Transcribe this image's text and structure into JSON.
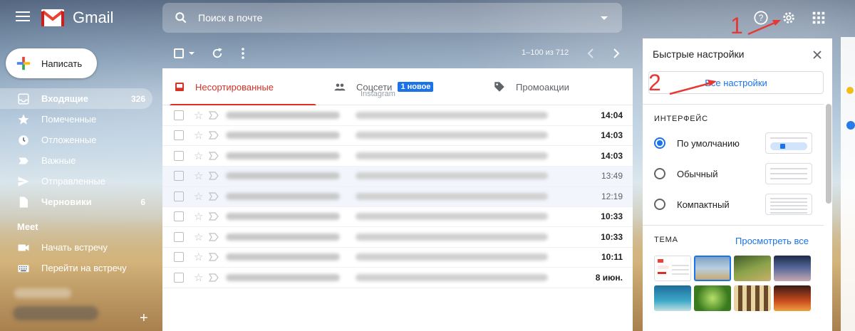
{
  "app": {
    "name": "Gmail"
  },
  "search": {
    "placeholder": "Поиск в почте"
  },
  "compose": {
    "label": "Написать"
  },
  "sidebar": {
    "items": [
      {
        "label": "Входящие",
        "count": "326",
        "icon": "inbox-icon",
        "active": true
      },
      {
        "label": "Помеченные",
        "count": "",
        "icon": "star-icon"
      },
      {
        "label": "Отложенные",
        "count": "",
        "icon": "clock-icon"
      },
      {
        "label": "Важные",
        "count": "",
        "icon": "label-important-icon"
      },
      {
        "label": "Отправленные",
        "count": "",
        "icon": "send-icon"
      },
      {
        "label": "Черновики",
        "count": "6",
        "icon": "draft-icon",
        "bold": true
      }
    ],
    "meet": {
      "title": "Meet",
      "items": [
        {
          "label": "Начать встречу",
          "icon": "videocam-icon"
        },
        {
          "label": "Перейти на встречу",
          "icon": "keyboard-icon"
        }
      ]
    }
  },
  "toolbar": {
    "pagination": "1–100 из 712"
  },
  "tabs": {
    "primary": {
      "label": "Несортированные"
    },
    "social": {
      "label": "Соцсети",
      "badge": "1 новое",
      "sub": "Instagram"
    },
    "promo": {
      "label": "Промоакции"
    }
  },
  "emails": [
    {
      "time": "14:04",
      "unread": true
    },
    {
      "time": "14:03",
      "unread": true
    },
    {
      "time": "14:03",
      "unread": true
    },
    {
      "time": "13:49",
      "unread": false
    },
    {
      "time": "12:19",
      "unread": false
    },
    {
      "time": "10:33",
      "unread": true
    },
    {
      "time": "10:33",
      "unread": true
    },
    {
      "time": "10:11",
      "unread": true
    },
    {
      "time": "8 июн.",
      "unread": true
    }
  ],
  "quick_settings": {
    "title": "Быстрые настройки",
    "all_settings": "Все настройки",
    "interface_section": "ИНТЕРФЕЙС",
    "density": [
      {
        "label": "По умолчанию",
        "selected": true
      },
      {
        "label": "Обычный",
        "selected": false
      },
      {
        "label": "Компактный",
        "selected": false
      }
    ],
    "theme_section": "ТЕМА",
    "view_all": "Просмотреть все"
  },
  "annotations": {
    "step1": "1",
    "step2": "2"
  },
  "colors": {
    "accent_red": "#d93025",
    "link_blue": "#1a73e8",
    "annotation_red": "#e53935"
  }
}
